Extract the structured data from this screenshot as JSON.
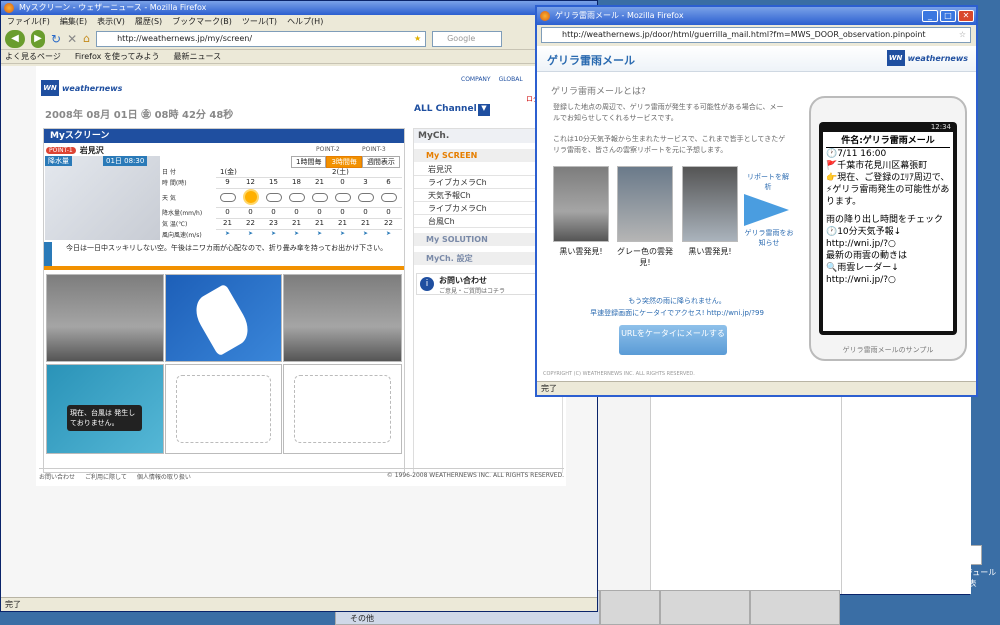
{
  "desktop": {
    "icon_label": "スケジュール表"
  },
  "win1": {
    "title": "Myスクリーン - ウェザーニュース - Mozilla Firefox",
    "menu": [
      "ファイル(F)",
      "編集(E)",
      "表示(V)",
      "履歴(S)",
      "ブックマーク(B)",
      "ツール(T)",
      "ヘルプ(H)"
    ],
    "url": "http://weathernews.jp/my/screen/",
    "search_placeholder": "Google",
    "bookmarks": [
      "よく見るページ",
      "Firefox を使ってみよう",
      "最新ニュース"
    ],
    "status": "完了",
    "page": {
      "brand": "weathernews",
      "links": [
        "COMPANY",
        "GLOBAL",
        "ログ"
      ],
      "date": "2008年 08月 01日 ㊎  08時 42分 48秒",
      "channel_select": "ALL Channel",
      "myscreen_title": "Myスクリーン",
      "point_tag": "POINT-1",
      "location": "岩見沢",
      "point2": "POINT-2",
      "point3": "POINT-3",
      "tabs": [
        "1時間毎",
        "3時間毎",
        "週間表示"
      ],
      "rain_label": "降水量",
      "map_time": "01日 08:30",
      "day1": "1(金)",
      "day2": "2(土)",
      "rows": [
        "日 付",
        "時 間(時)",
        "天 気",
        "降水量(mm/h)",
        "気 温(℃)",
        "風向風速(m/s)"
      ],
      "hours": [
        "9",
        "12",
        "15",
        "18",
        "21",
        "0",
        "3",
        "6"
      ],
      "precip": [
        "0",
        "0",
        "0",
        "0",
        "0",
        "0",
        "0",
        "0"
      ],
      "temps": [
        "21",
        "22",
        "23",
        "21",
        "21",
        "21",
        "21",
        "22"
      ],
      "forecast_text": "今日は一日中スッキリしない空。午後はニワカ雨が心配なので、折り畳み傘を持ってお出かけ下さい。",
      "typhoon_text": "現在、台風は 発生しておりません。",
      "footer_links": [
        "お問い合わせ",
        "ご利用に際して",
        "個人情報の取り扱い"
      ],
      "copyright": "© 1996-2008 WEATHERNEWS INC. ALL RIGHTS RESERVED."
    },
    "sidebar": {
      "mych": "MyCh.",
      "my_screen": "My SCREEN",
      "items": [
        "岩見沢",
        "ライブカメラCh",
        "天気予報Ch",
        "ライブカメラCh",
        "台風Ch"
      ],
      "my_solution": "My SOLUTION",
      "mych_settings": "MyCh. 設定",
      "contact_title": "お問い合わせ",
      "contact_sub": "ご意見・ご質問はコチラ"
    }
  },
  "win2": {
    "title": "ゲリラ雷雨メール - Mozilla Firefox",
    "url": "http://weathernews.jp/door/html/guerrilla_mail.html?fm=MWS_DOOR_observation.pinpoint",
    "header": "ゲリラ雷雨メール",
    "brand": "weathernews",
    "question": "ゲリラ雷雨メールとは?",
    "desc1": "登録した地点の周辺で、ゲリラ雷雨が発生する可能性がある場合に、メールでお知らせしてくれるサービスです。",
    "desc2": "これは10分天気予報から生まれたサービスで、これまで皆手としてきたゲリラ雷雨を、皆さんの雲察リポートを元に予想します。",
    "photos": [
      "黒い雲発見!",
      "グレー色の雲発見!",
      "黒い雲発見!"
    ],
    "arrow_top": "リポートを解析",
    "arrow_bottom": "ゲリラ雷雨をお知らせ",
    "access1": "もう突然の雨に降られません。",
    "access2": "早速登録画面にケータイでアクセス! http://wni.jp/?99",
    "button": "URLをケータイにメールする",
    "phone_time": "12:34",
    "mail_subject": "件名:ゲリラ雷雨メール",
    "mail_lines": [
      "🕐7/11 16:00",
      "🚩千葉市花見川区幕張町",
      "👉現在、ご登録のｴﾘｱ周辺で、⚡ゲリラ雷雨発生の可能性があります。",
      "雨の降り出し時間をチェック",
      "🕐10分天気予報↓",
      "http://wni.jp/?○",
      "最新の雨雲の動きは",
      "🔍雨雲レーダー↓",
      "http://wni.jp/?○"
    ],
    "phone_caption": "ゲリラ雷雨メールのサンプル",
    "copyright": "COPYRIGHT (C) WEATHERNEWS INC. ALL RIGHTS RESERVED.",
    "status": "完了"
  },
  "taskbar": {
    "item": "その他"
  }
}
